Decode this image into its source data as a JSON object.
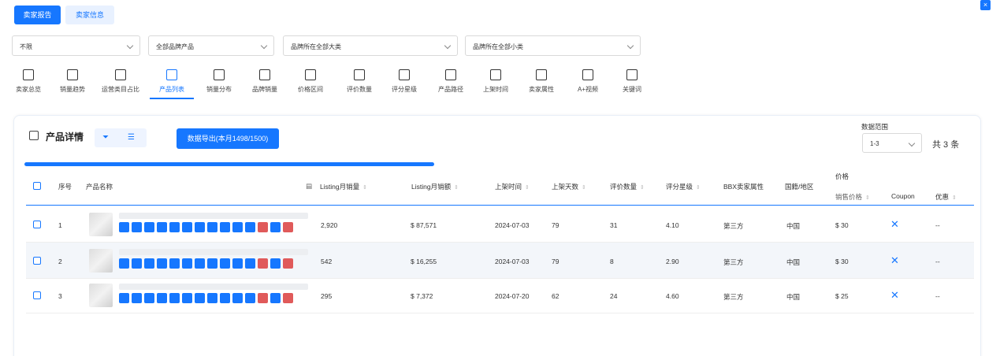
{
  "top_tabs": {
    "report": "卖家报告",
    "info": "卖家信息"
  },
  "filters": [
    "不限",
    "全部品牌产品",
    "品牌所在全部大类",
    "品牌所在全部小类"
  ],
  "nav": [
    {
      "label": "卖家总览",
      "icon": "user-icon"
    },
    {
      "label": "销量趋势",
      "icon": "trend-icon"
    },
    {
      "label": "运营类目占比",
      "icon": "category-icon"
    },
    {
      "label": "产品列表",
      "icon": "list-icon"
    },
    {
      "label": "销量分布",
      "icon": "bar-chart-icon"
    },
    {
      "label": "品牌销量",
      "icon": "brand-icon"
    },
    {
      "label": "价格区间",
      "icon": "price-icon"
    },
    {
      "label": "评价数量",
      "icon": "review-icon"
    },
    {
      "label": "评分星级",
      "icon": "star-icon"
    },
    {
      "label": "产品路径",
      "icon": "tree-icon"
    },
    {
      "label": "上架时间",
      "icon": "calendar-icon"
    },
    {
      "label": "卖家属性",
      "icon": "archive-icon"
    },
    {
      "label": "A+视频",
      "icon": "video-icon"
    },
    {
      "label": "关键词",
      "icon": "keyword-icon"
    }
  ],
  "panel": {
    "title": "产品详情",
    "export": "数据导出(本月1498/1500)",
    "range_label": "数据范围",
    "range_value": "1-3",
    "total": "共 3 条"
  },
  "headers": {
    "index": "序号",
    "name": "产品名称",
    "listing_sales": "Listing月销量",
    "listing_revenue": "Listing月销额",
    "date": "上架时间",
    "days": "上架天数",
    "reviews": "评价数量",
    "rating": "评分星级",
    "bbx": "BBX卖家属性",
    "country": "国籍/地区",
    "price": "价格",
    "sale_price": "销售价格",
    "coupon": "Coupon",
    "discount": "优惠"
  },
  "rows": [
    {
      "index": "1",
      "sales": "2,920",
      "revenue": "$ 87,571",
      "date": "2024-07-03",
      "days": "79",
      "reviews": "31",
      "rating": "4.10",
      "bbx": "第三方",
      "country": "中国",
      "price": "$ 30",
      "discount": "--"
    },
    {
      "index": "2",
      "sales": "542",
      "revenue": "$ 16,255",
      "date": "2024-07-03",
      "days": "79",
      "reviews": "8",
      "rating": "2.90",
      "bbx": "第三方",
      "country": "中国",
      "price": "$ 30",
      "discount": "--"
    },
    {
      "index": "3",
      "sales": "295",
      "revenue": "$ 7,372",
      "date": "2024-07-20",
      "days": "62",
      "reviews": "24",
      "rating": "4.60",
      "bbx": "第三方",
      "country": "中国",
      "price": "$ 25",
      "discount": "--"
    }
  ],
  "colors": {
    "accent": "#1677ff"
  }
}
